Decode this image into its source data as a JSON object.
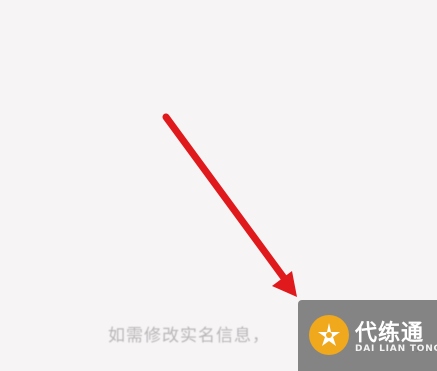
{
  "screen": {
    "hint_text": "如需修改实名信息，"
  },
  "annotation": {
    "arrow_color": "#e0191c",
    "arrow_icon": "red-arrow-icon"
  },
  "watermark": {
    "title": "代练通",
    "subtitle": "DAI LIAN TONG",
    "logo_color": "#f0a81d"
  }
}
